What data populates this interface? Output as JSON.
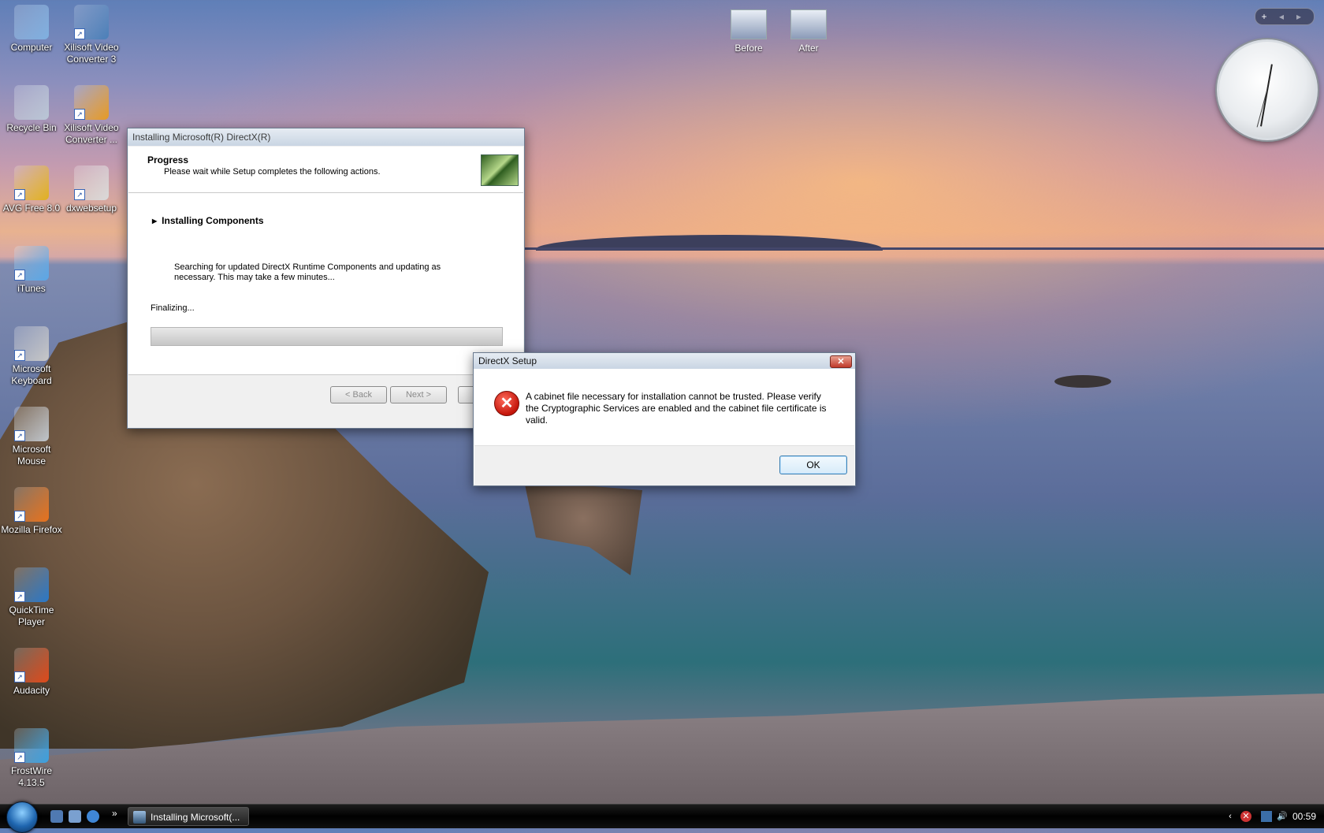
{
  "desktop": {
    "icons": [
      {
        "label": "Computer",
        "icon": "computer-icon",
        "color": "#7fb0e0"
      },
      {
        "label": "Xilisoft Video Converter 3",
        "icon": "video-converter-icon",
        "color": "#4a7fb8"
      },
      {
        "label": "Recycle Bin",
        "icon": "recycle-bin-icon",
        "color": "#b9c6d6"
      },
      {
        "label": "Xilisoft Video Converter ...",
        "icon": "video-converter-icon",
        "color": "#e59a24"
      },
      {
        "label": "AVG Free 8.0",
        "icon": "avg-icon",
        "color": "#e0b020"
      },
      {
        "label": "dxwebsetup",
        "icon": "setup-icon",
        "color": "#d9d9d9"
      },
      {
        "label": "iTunes",
        "icon": "itunes-icon",
        "color": "#5aa7e6"
      },
      {
        "label": "Microsoft Keyboard",
        "icon": "keyboard-icon",
        "color": "#c7c7c7"
      },
      {
        "label": "Microsoft Mouse",
        "icon": "mouse-icon",
        "color": "#bfc5cb"
      },
      {
        "label": "Mozilla Firefox",
        "icon": "firefox-icon",
        "color": "#e8721c"
      },
      {
        "label": "QuickTime Player",
        "icon": "quicktime-icon",
        "color": "#2a78c8"
      },
      {
        "label": "Audacity",
        "icon": "audacity-icon",
        "color": "#e04a1a"
      },
      {
        "label": "FrostWire 4.13.5",
        "icon": "frostwire-icon",
        "color": "#3aa0e0"
      }
    ],
    "gadget_icons": [
      {
        "label": "Before"
      },
      {
        "label": "After"
      }
    ]
  },
  "sidebar": {
    "add": "+",
    "prev": "◂",
    "next": "▸"
  },
  "installer": {
    "title": "Installing Microsoft(R) DirectX(R)",
    "header_title": "Progress",
    "header_subtitle": "Please wait while Setup completes the following actions.",
    "section": "Installing Components",
    "description": "Searching for updated DirectX Runtime Components and updating as necessary. This may take a few minutes...",
    "status": "Finalizing...",
    "progress": 0,
    "back_label": "< Back",
    "next_label": "Next >"
  },
  "dialog": {
    "title": "DirectX Setup",
    "close": "✕",
    "message": "A cabinet file necessary for installation cannot be trusted. Please verify the Cryptographic Services are enabled and the cabinet file certificate is valid.",
    "ok_label": "OK"
  },
  "taskbar": {
    "task_label": "Installing Microsoft(...",
    "overflow": "»",
    "clock": "00:59"
  }
}
